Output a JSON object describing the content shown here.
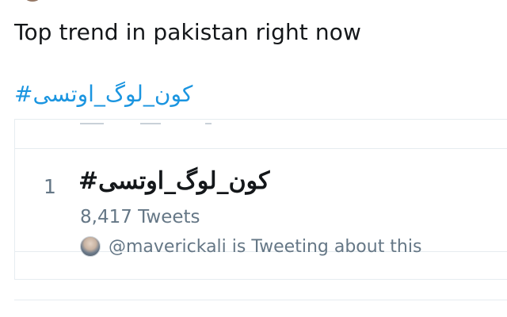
{
  "tweet": {
    "text": "Top trend in pakistan right now",
    "hashtag": "#کون_لوگ_اوتسی"
  },
  "trend_card": {
    "rank": "1",
    "name": "#کون_لوگ_اوتسی",
    "tweet_count": "8,417 Tweets",
    "context": "@maverickali is Tweeting about this"
  },
  "colors": {
    "link": "#1b95e0",
    "text": "#14171a",
    "secondary": "#657786",
    "border": "#e6ecf0"
  }
}
